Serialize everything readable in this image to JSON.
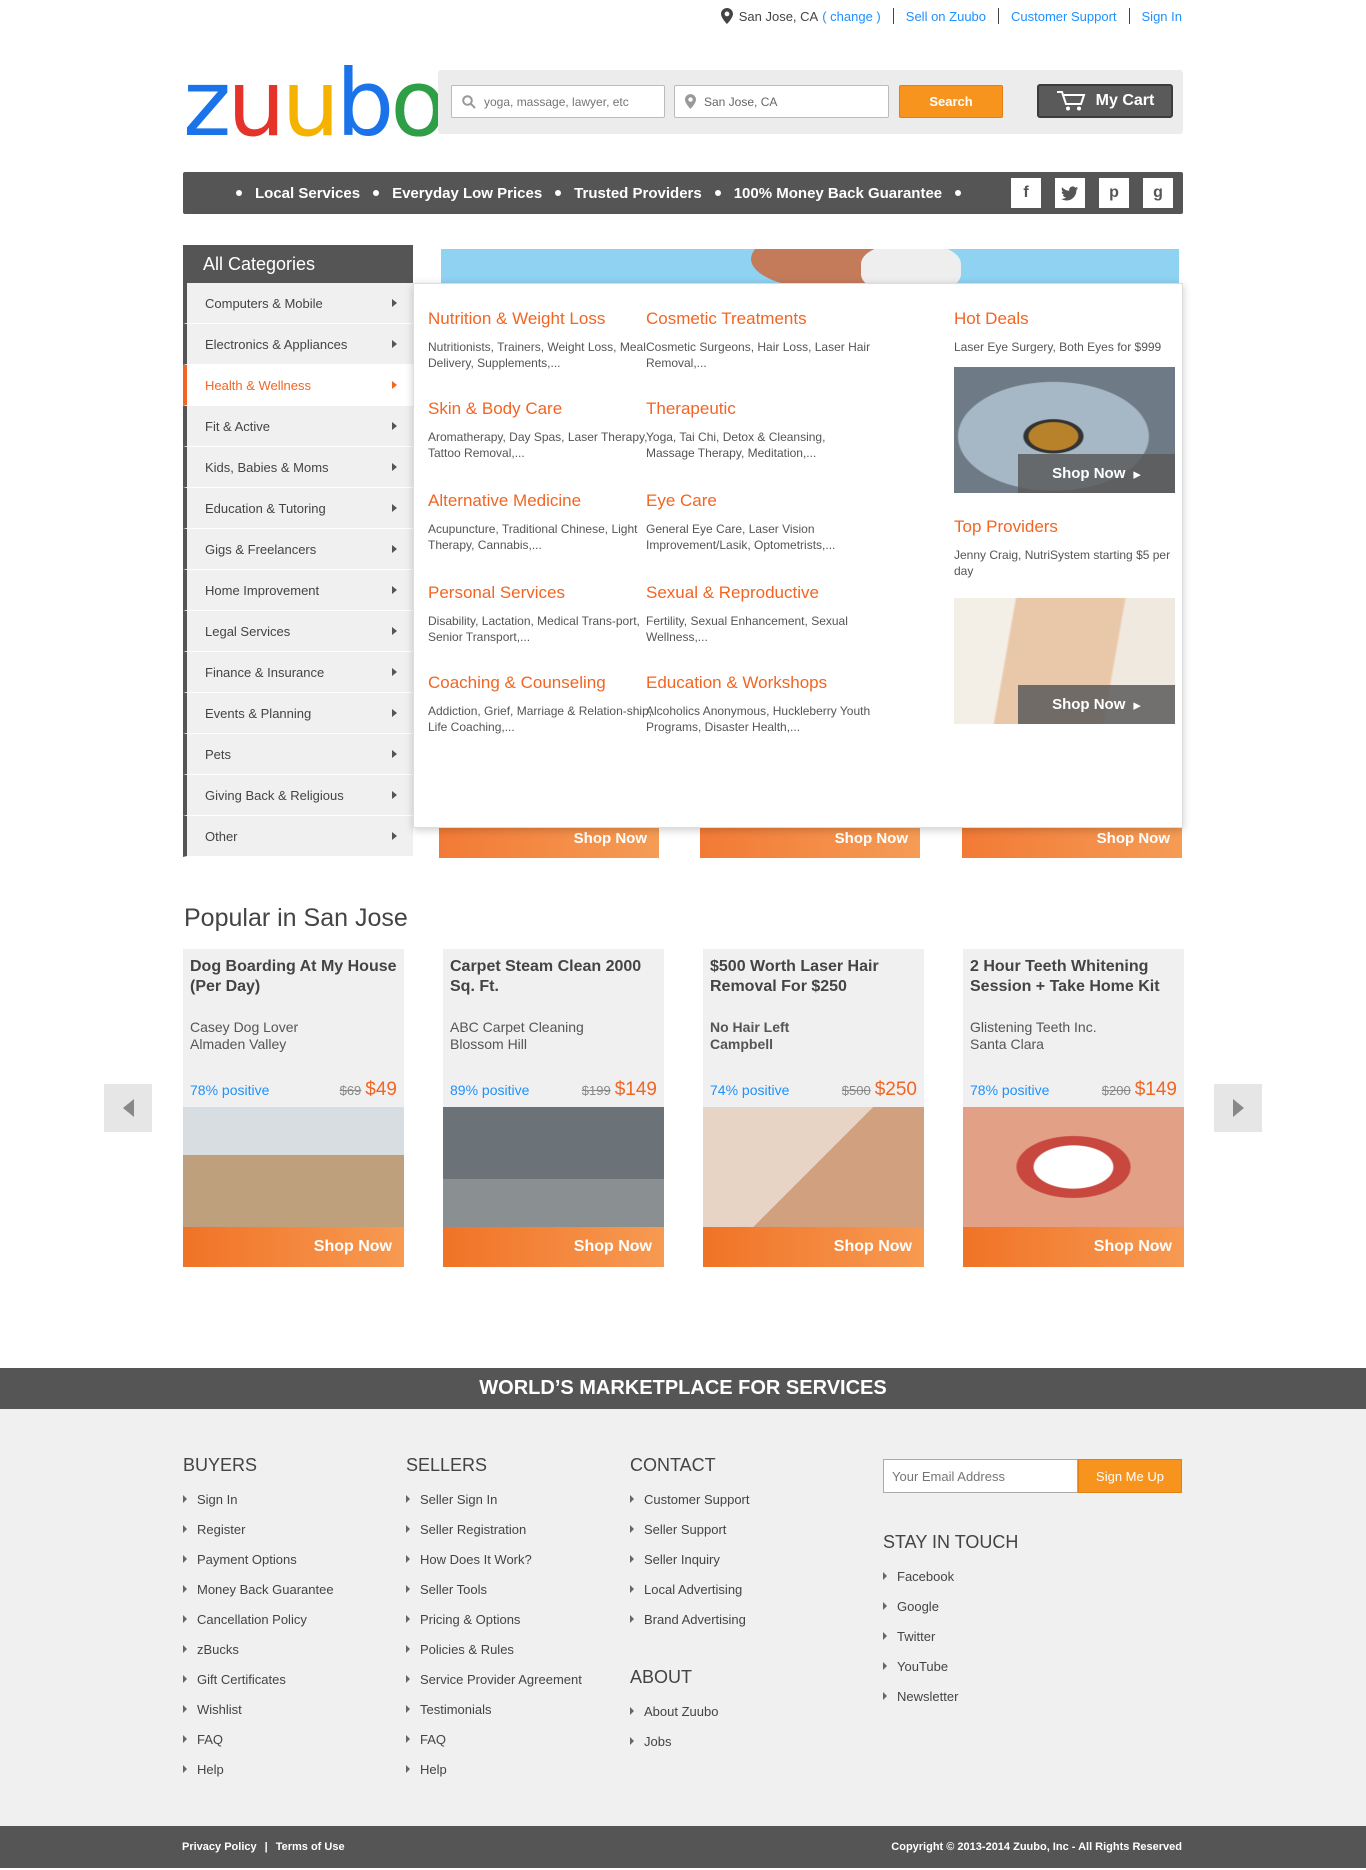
{
  "top": {
    "location": "San Jose, CA",
    "change": "( change )",
    "links": [
      "Sell on Zuubo",
      "Customer Support",
      "Sign In"
    ]
  },
  "logo": "zuubo",
  "search": {
    "what_placeholder": "yoga, massage, lawyer, etc",
    "where_value": "San Jose, CA",
    "button": "Search",
    "cart": "My Cart"
  },
  "nav": {
    "features": [
      "Local Services",
      "Everyday Low Prices",
      "Trusted Providers",
      "100% Money Back Guarantee"
    ],
    "social": [
      "f",
      "t",
      "p",
      "g"
    ]
  },
  "sidebar": {
    "title": "All Categories",
    "items": [
      "Computers & Mobile",
      "Electronics & Appliances",
      "Health & Wellness",
      "Fit & Active",
      "Kids, Babies & Moms",
      "Education & Tutoring",
      "Gigs & Freelancers",
      "Home Improvement",
      "Legal Services",
      "Finance & Insurance",
      "Events & Planning",
      "Pets",
      "Giving Back & Religious",
      "Other"
    ],
    "active_index": 2
  },
  "dropdown": {
    "categories": [
      {
        "title": "Nutrition & Weight Loss",
        "desc": "Nutritionists, Trainers, Weight Loss, Meal Delivery, Supplements,..."
      },
      {
        "title": "Cosmetic Treatments",
        "desc": "Cosmetic Surgeons, Hair Loss, Laser Hair Removal,..."
      },
      {
        "title": "Skin & Body Care",
        "desc": "Aromatherapy, Day Spas, Laser Therapy, Tattoo Removal,..."
      },
      {
        "title": "Therapeutic",
        "desc": "Yoga, Tai Chi, Detox & Cleansing, Massage Therapy, Meditation,..."
      },
      {
        "title": "Alternative Medicine",
        "desc": "Acupuncture, Traditional Chinese, Light Therapy, Cannabis,..."
      },
      {
        "title": "Eye Care",
        "desc": "General Eye Care, Laser Vision Improvement/Lasik, Optometrists,..."
      },
      {
        "title": "Personal Services",
        "desc": "Disability, Lactation, Medical Trans-port, Senior Transport,..."
      },
      {
        "title": "Sexual & Reproductive",
        "desc": "Fertility, Sexual Enhancement, Sexual Wellness,..."
      },
      {
        "title": "Coaching & Counseling",
        "desc": "Addiction, Grief, Marriage & Relation-ship, Life Coaching,..."
      },
      {
        "title": "Education & Workshops",
        "desc": "Alcoholics Anonymous, Huckleberry Youth Programs, Disaster Health,..."
      }
    ],
    "hot_deals": {
      "title": "Hot Deals",
      "desc": "Laser Eye Surgery, Both Eyes for $999",
      "shop": "Shop Now"
    },
    "top_providers": {
      "title": "Top Providers",
      "desc": "Jenny Craig, NutriSystem starting $5 per day",
      "shop": "Shop Now"
    },
    "strip_shop": "Shop Now"
  },
  "popular": {
    "title": "Popular in San Jose",
    "cards": [
      {
        "title": "Dog Boarding At My House (Per Day)",
        "vendor": "Casey Dog Lover",
        "area": "Almaden Valley",
        "positive": "78% positive",
        "old": "$69",
        "price": "$49",
        "shop": "Shop Now",
        "img": "dog-photo"
      },
      {
        "title": "Carpet Steam Clean 2000 Sq. Ft.",
        "vendor": "ABC Carpet Cleaning",
        "area": "Blossom Hill",
        "positive": "89% positive",
        "old": "$199",
        "price": "$149",
        "shop": "Shop Now",
        "img": "carpet-photo"
      },
      {
        "title": "$500 Worth Laser Hair Removal For $250",
        "vendor": "No Hair Left",
        "area": "Campbell",
        "positive": "74% positive",
        "old": "$500",
        "price": "$250",
        "shop": "Shop Now",
        "img": "laser-photo"
      },
      {
        "title": "2 Hour Teeth Whitening Session + Take Home Kit",
        "vendor": "Glistening Teeth Inc.",
        "area": "Santa Clara",
        "positive": "78% positive",
        "old": "$200",
        "price": "$149",
        "shop": "Shop Now",
        "img": "teeth-photo"
      }
    ]
  },
  "footer": {
    "banner": "WORLD’S MARKETPLACE FOR SERVICES",
    "buyers": {
      "title": "BUYERS",
      "items": [
        "Sign In",
        "Register",
        "Payment Options",
        "Money Back Guarantee",
        "Cancellation Policy",
        "zBucks",
        "Gift Certificates",
        "Wishlist",
        "FAQ",
        "Help"
      ]
    },
    "sellers": {
      "title": "SELLERS",
      "items": [
        "Seller Sign In",
        "Seller Registration",
        "How Does It Work?",
        "Seller Tools",
        "Pricing & Options",
        "Policies & Rules",
        "Service Provider Agreement",
        "Testimonials",
        "FAQ",
        "Help"
      ]
    },
    "contact": {
      "title": "CONTACT",
      "items": [
        "Customer Support",
        "Seller Support",
        "Seller Inquiry",
        "Local Advertising",
        "Brand Advertising"
      ]
    },
    "about": {
      "title": "ABOUT",
      "items": [
        "About Zuubo",
        "Jobs"
      ]
    },
    "email_placeholder": "Your Email Address",
    "signup": "Sign Me Up",
    "stay": {
      "title": "STAY IN TOUCH",
      "items": [
        "Facebook",
        "Google",
        "Twitter",
        "YouTube",
        "Newsletter"
      ]
    },
    "privacy": "Privacy Policy",
    "divider": "|",
    "terms": "Terms of Use",
    "copyright": "Copyright © 2013-2014 Zuubo, Inc - All Rights Reserved"
  },
  "colors": {
    "accent": "#f26522",
    "button": "#f7941d",
    "link": "#1e90ff",
    "dark": "#555555"
  }
}
